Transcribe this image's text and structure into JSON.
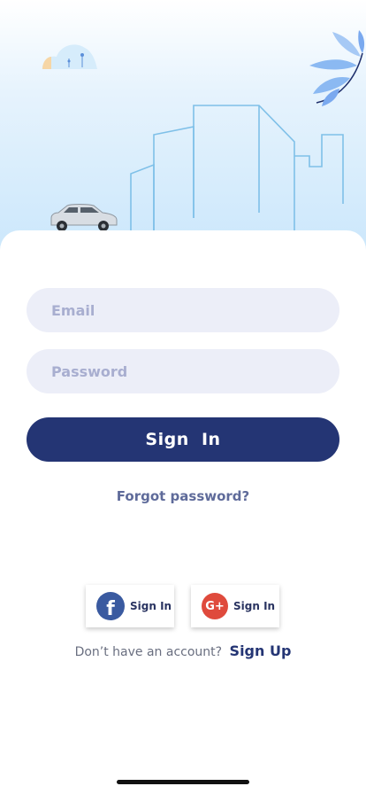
{
  "login": {
    "email_placeholder": "Email",
    "password_placeholder": "Password",
    "signin_label": "Sign  In",
    "forgot_label": "Forgot password?"
  },
  "social": {
    "facebook_icon_letter": "f",
    "facebook_label": "Sign In",
    "google_icon_letter": "G+",
    "google_label": "Sign In"
  },
  "signup": {
    "prompt": "Don’t have an account?",
    "link_label": "Sign Up"
  },
  "colors": {
    "primary": "#243574",
    "field_bg": "#eceef8",
    "facebook": "#3a5aa0",
    "google": "#df4a3c",
    "sky": "#c9e6fb"
  },
  "icons": [
    "cloud-icon",
    "palm-leaf-icon",
    "city-skyline-icon",
    "car-icon",
    "facebook-icon",
    "google-plus-icon"
  ]
}
